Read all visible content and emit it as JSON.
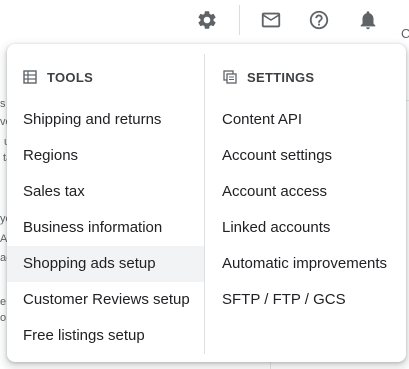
{
  "topbar": {
    "icons": [
      "gear-icon",
      "mail-icon",
      "help-icon",
      "bell-icon"
    ],
    "edge_letter": "C"
  },
  "background": {
    "fragments": [
      "s",
      "vo",
      "u",
      "ta",
      "yo",
      "Ah",
      "ac",
      "e",
      "o"
    ]
  },
  "menu": {
    "tools": {
      "heading": "TOOLS",
      "icon": "table-icon",
      "items": [
        {
          "label": "Shipping and returns"
        },
        {
          "label": "Regions"
        },
        {
          "label": "Sales tax"
        },
        {
          "label": "Business information"
        },
        {
          "label": "Shopping ads setup",
          "active": true
        },
        {
          "label": "Customer Reviews setup"
        },
        {
          "label": "Free listings setup"
        }
      ]
    },
    "settings": {
      "heading": "SETTINGS",
      "icon": "copy-settings-icon",
      "items": [
        {
          "label": "Content API"
        },
        {
          "label": "Account settings"
        },
        {
          "label": "Account access"
        },
        {
          "label": "Linked accounts"
        },
        {
          "label": "Automatic improvements"
        },
        {
          "label": "SFTP / FTP / GCS"
        }
      ]
    }
  },
  "colors": {
    "icon_gray": "#5f6368",
    "text_dark": "#202124",
    "active_bg": "#f1f3f4"
  }
}
